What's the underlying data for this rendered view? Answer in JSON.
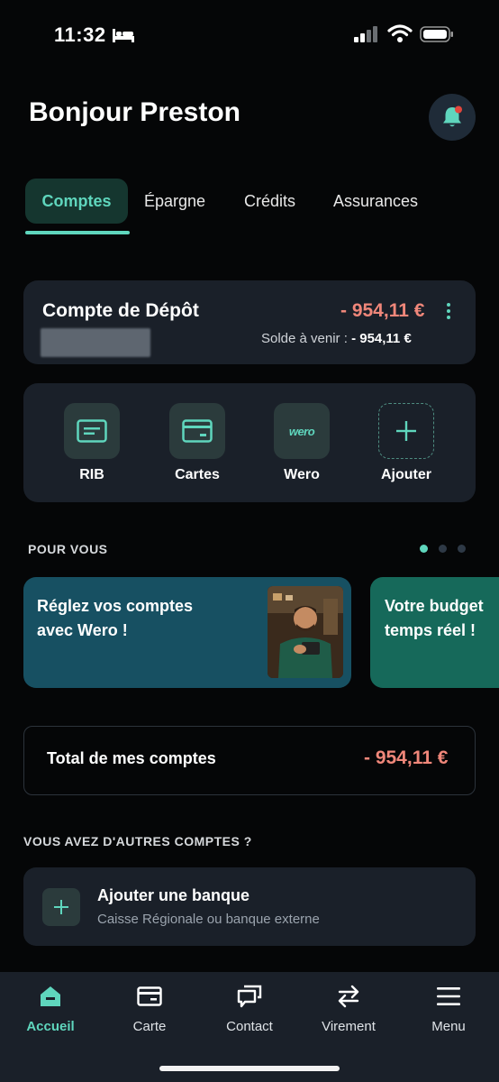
{
  "status_bar": {
    "time": "11:32"
  },
  "header": {
    "greeting": "Bonjour Preston"
  },
  "tabs": [
    {
      "label": "Comptes"
    },
    {
      "label": "Épargne"
    },
    {
      "label": "Crédits"
    },
    {
      "label": "Assurances"
    }
  ],
  "account": {
    "name": "Compte de Dépôt",
    "balance": "- 954,11 €",
    "upcoming_label": "Solde à venir :",
    "upcoming_value": "- 954,11 €"
  },
  "quick_actions": [
    {
      "label": "RIB",
      "icon": "rib-icon"
    },
    {
      "label": "Cartes",
      "icon": "card-icon"
    },
    {
      "label": "Wero",
      "icon": "wero-logo",
      "logo_text": "wero"
    },
    {
      "label": "Ajouter",
      "icon": "plus-icon"
    }
  ],
  "pour_vous": {
    "title": "POUR VOUS",
    "carousel_active_index": 0,
    "carousel_count": 3,
    "cards": [
      {
        "text_line1": "Réglez vos comptes",
        "text_line2": "avec Wero !"
      },
      {
        "text_line1": "Votre budget",
        "text_line2": "temps réel !"
      }
    ]
  },
  "total": {
    "label": "Total de mes comptes",
    "value": "- 954,11 €"
  },
  "other_accounts": {
    "title": "VOUS AVEZ D'AUTRES COMPTES ?",
    "add_bank_title": "Ajouter une banque",
    "add_bank_subtitle": "Caisse Régionale ou banque externe"
  },
  "bottom_nav": [
    {
      "label": "Accueil",
      "icon": "home-icon",
      "active": true
    },
    {
      "label": "Carte",
      "icon": "card-icon",
      "active": false
    },
    {
      "label": "Contact",
      "icon": "chat-icon",
      "active": false
    },
    {
      "label": "Virement",
      "icon": "transfer-icon",
      "active": false
    },
    {
      "label": "Menu",
      "icon": "menu-icon",
      "active": false
    }
  ],
  "colors": {
    "accent": "#5fd6bd",
    "negative": "#f0877a",
    "surface": "#1a2029",
    "background": "#050607"
  }
}
